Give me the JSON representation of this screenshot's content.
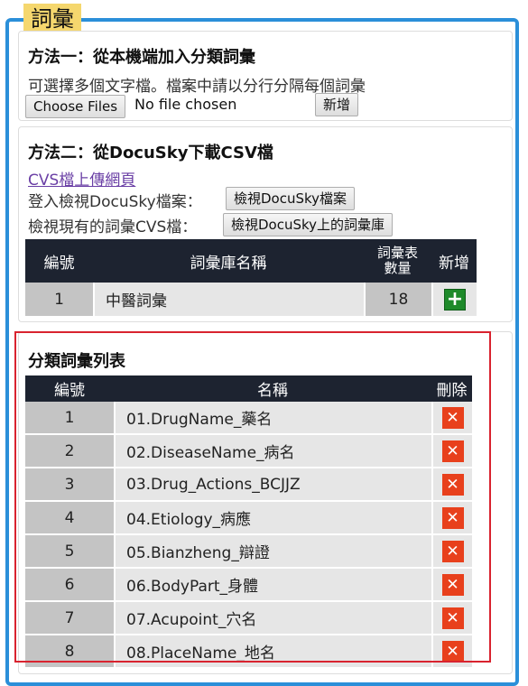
{
  "section": {
    "title": "詞彙"
  },
  "method1": {
    "title": "方法一：從本機端加入分類詞彙",
    "desc": "可選擇多個文字檔。檔案中請以分行分隔每個詞彙",
    "choose_files": "Choose Files",
    "no_file": "No file chosen",
    "add_button": "新增"
  },
  "method2": {
    "title": "方法二：從DocuSky下載CSV檔",
    "upload_link": "CVS檔上傳網頁",
    "login_label": "登入檢視DocuSky檔案：",
    "login_button": "檢視DocuSky檔案",
    "view_label": "檢視現有的詞彙CVS檔：",
    "view_button": "檢視DocuSky上的詞彙庫",
    "table": {
      "headers": {
        "num": "編號",
        "name": "詞彙庫名稱",
        "count": "詞彙表數量",
        "add": "新增"
      },
      "rows": [
        {
          "num": "1",
          "name": "中醫詞彙",
          "count": "18"
        }
      ]
    }
  },
  "category_list": {
    "title": "分類詞彙列表",
    "headers": {
      "num": "編號",
      "name": "名稱",
      "delete": "刪除"
    },
    "rows": [
      {
        "num": "1",
        "name": "01.DrugName_藥名"
      },
      {
        "num": "2",
        "name": "02.DiseaseName_病名"
      },
      {
        "num": "3",
        "name": "03.Drug_Actions_BCJJZ"
      },
      {
        "num": "4",
        "name": "04.Etiology_病應"
      },
      {
        "num": "5",
        "name": "05.Bianzheng_辯證"
      },
      {
        "num": "6",
        "name": "06.BodyPart_身體"
      },
      {
        "num": "7",
        "name": "07.Acupoint_穴名"
      },
      {
        "num": "8",
        "name": "08.PlaceName_地名"
      }
    ]
  },
  "icons": {
    "add": "plus-icon",
    "delete": "close-icon"
  },
  "colors": {
    "frame": "#2b8fd9",
    "title_bg": "#f5d76e",
    "header_bg": "#1d2330",
    "add_btn": "#1e8a2a",
    "delete_btn": "#e8401c",
    "highlight": "#d9232f"
  }
}
